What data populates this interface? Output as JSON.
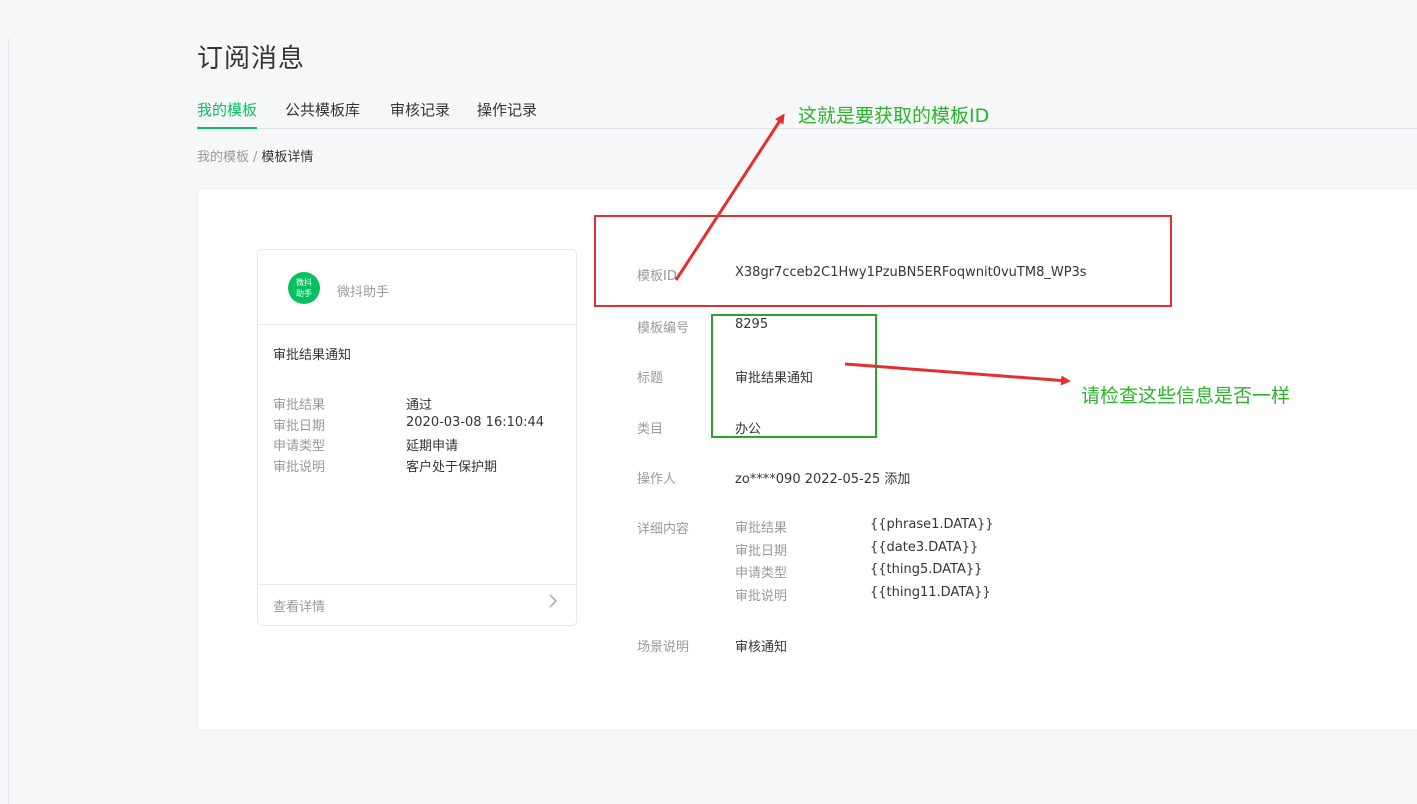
{
  "page": {
    "title": "订阅消息"
  },
  "tabs": [
    {
      "label": "我的模板",
      "active": true
    },
    {
      "label": "公共模板库",
      "active": false
    },
    {
      "label": "审核记录",
      "active": false
    },
    {
      "label": "操作记录",
      "active": false
    }
  ],
  "breadcrumb": {
    "parent": "我的模板",
    "separator": "/",
    "current": "模板详情"
  },
  "preview": {
    "avatar_text_line1": "微抖",
    "avatar_text_line2": "助手",
    "account_name": "微抖助手",
    "message_title": "审批结果通知",
    "rows": [
      {
        "key": "审批结果",
        "value": "通过"
      },
      {
        "key": "审批日期",
        "value": "2020-03-08 16:10:44"
      },
      {
        "key": "申请类型",
        "value": "延期申请"
      },
      {
        "key": "审批说明",
        "value": "客户处于保护期"
      }
    ],
    "footer_label": "查看详情",
    "footer_icon": "chevron-right-icon"
  },
  "info": {
    "template_id_label": "模板ID",
    "template_id": "X38gr7cceb2C1Hwy1PzuBN5ERFoqwnit0vuTM8_WP3s",
    "template_no_label": "模板编号",
    "template_no": "8295",
    "title_label": "标题",
    "title": "审批结果通知",
    "category_label": "类目",
    "category": "办公",
    "operator_label": "操作人",
    "operator": "zo****090 2022-05-25 添加",
    "detail_label": "详细内容",
    "detail": [
      {
        "key": "审批结果",
        "value": "{{phrase1.DATA}}"
      },
      {
        "key": "审批日期",
        "value": "{{date3.DATA}}"
      },
      {
        "key": "申请类型",
        "value": "{{thing5.DATA}}"
      },
      {
        "key": "审批说明",
        "value": "{{thing11.DATA}}"
      }
    ],
    "scene_label": "场景说明",
    "scene": "审核通知"
  },
  "annotations": {
    "template_id_note": "这就是要获取的模板ID",
    "check_note": "请检查这些信息是否一样"
  },
  "colors": {
    "accent": "#07c160",
    "annotation_red": "#e62e2e",
    "annotation_green": "#2aa52a"
  }
}
